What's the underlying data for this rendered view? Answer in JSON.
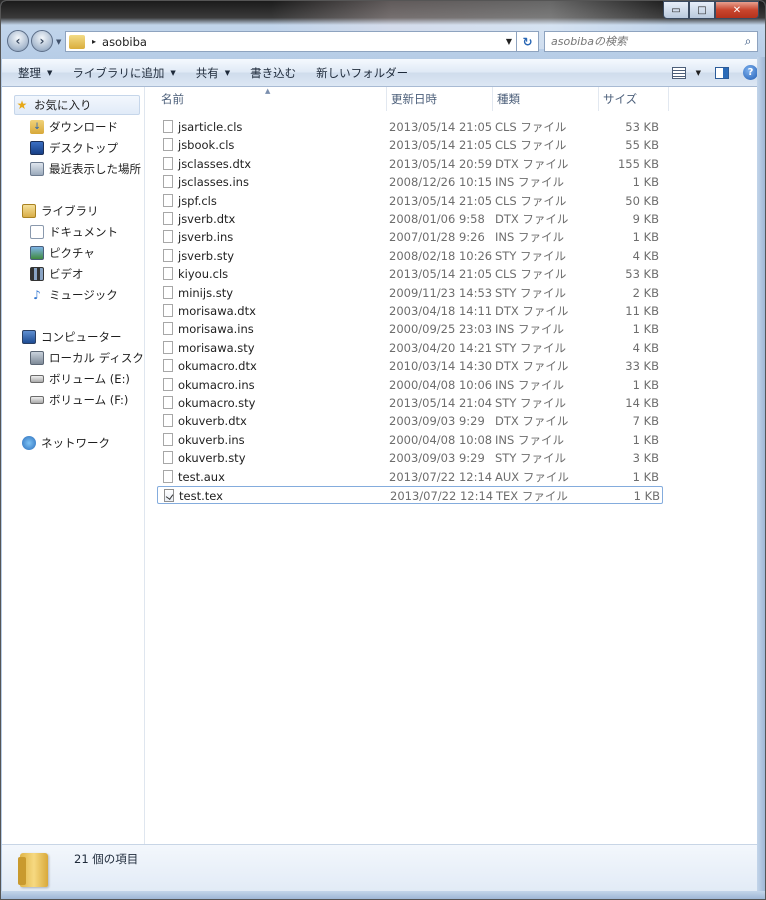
{
  "window": {
    "minimize_glyph": "▭",
    "maximize_glyph": "□",
    "close_glyph": "✕"
  },
  "address": {
    "path": "asobiba",
    "separator": "▸",
    "search_placeholder": "asobibaの検索"
  },
  "toolbar": {
    "organize": "整理",
    "add_to_library": "ライブラリに追加",
    "share": "共有",
    "burn": "書き込む",
    "new_folder": "新しいフォルダー"
  },
  "nav": {
    "favorites": "お気に入り",
    "downloads": "ダウンロード",
    "desktop": "デスクトップ",
    "recent": "最近表示した場所",
    "libraries": "ライブラリ",
    "documents": "ドキュメント",
    "pictures": "ピクチャ",
    "videos": "ビデオ",
    "music": "ミュージック",
    "computer": "コンピューター",
    "local_disk": "ローカル ディスク (",
    "volume_e": "ボリューム (E:)",
    "volume_f": "ボリューム (F:)",
    "network": "ネットワーク"
  },
  "columns": {
    "name": "名前",
    "date": "更新日時",
    "type": "種類",
    "size": "サイズ"
  },
  "files": [
    {
      "name": "jsarticle.cls",
      "date": "2013/05/14 21:05",
      "type": "CLS ファイル",
      "size": "53 KB"
    },
    {
      "name": "jsbook.cls",
      "date": "2013/05/14 21:05",
      "type": "CLS ファイル",
      "size": "55 KB"
    },
    {
      "name": "jsclasses.dtx",
      "date": "2013/05/14 20:59",
      "type": "DTX ファイル",
      "size": "155 KB"
    },
    {
      "name": "jsclasses.ins",
      "date": "2008/12/26 10:15",
      "type": "INS ファイル",
      "size": "1 KB"
    },
    {
      "name": "jspf.cls",
      "date": "2013/05/14 21:05",
      "type": "CLS ファイル",
      "size": "50 KB"
    },
    {
      "name": "jsverb.dtx",
      "date": "2008/01/06 9:58",
      "type": "DTX ファイル",
      "size": "9 KB"
    },
    {
      "name": "jsverb.ins",
      "date": "2007/01/28 9:26",
      "type": "INS ファイル",
      "size": "1 KB"
    },
    {
      "name": "jsverb.sty",
      "date": "2008/02/18 10:26",
      "type": "STY ファイル",
      "size": "4 KB"
    },
    {
      "name": "kiyou.cls",
      "date": "2013/05/14 21:05",
      "type": "CLS ファイル",
      "size": "53 KB"
    },
    {
      "name": "minijs.sty",
      "date": "2009/11/23 14:53",
      "type": "STY ファイル",
      "size": "2 KB"
    },
    {
      "name": "morisawa.dtx",
      "date": "2003/04/18 14:11",
      "type": "DTX ファイル",
      "size": "11 KB"
    },
    {
      "name": "morisawa.ins",
      "date": "2000/09/25 23:03",
      "type": "INS ファイル",
      "size": "1 KB"
    },
    {
      "name": "morisawa.sty",
      "date": "2003/04/20 14:21",
      "type": "STY ファイル",
      "size": "4 KB"
    },
    {
      "name": "okumacro.dtx",
      "date": "2010/03/14 14:30",
      "type": "DTX ファイル",
      "size": "33 KB"
    },
    {
      "name": "okumacro.ins",
      "date": "2000/04/08 10:06",
      "type": "INS ファイル",
      "size": "1 KB"
    },
    {
      "name": "okumacro.sty",
      "date": "2013/05/14 21:04",
      "type": "STY ファイル",
      "size": "14 KB"
    },
    {
      "name": "okuverb.dtx",
      "date": "2003/09/03 9:29",
      "type": "DTX ファイル",
      "size": "7 KB"
    },
    {
      "name": "okuverb.ins",
      "date": "2000/04/08 10:08",
      "type": "INS ファイル",
      "size": "1 KB"
    },
    {
      "name": "okuverb.sty",
      "date": "2003/09/03 9:29",
      "type": "STY ファイル",
      "size": "3 KB"
    },
    {
      "name": "test.aux",
      "date": "2013/07/22 12:14",
      "type": "AUX ファイル",
      "size": "1 KB"
    },
    {
      "name": "test.tex",
      "date": "2013/07/22 12:14",
      "type": "TEX ファイル",
      "size": "1 KB"
    }
  ],
  "status": {
    "item_count": "21 個の項目"
  }
}
